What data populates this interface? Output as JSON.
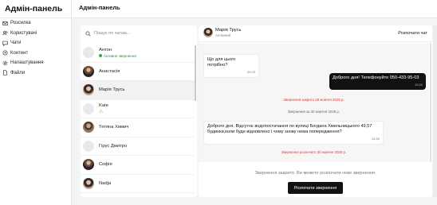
{
  "app": {
    "brand": "Адмін-панель",
    "page_title": "Адмін-панель"
  },
  "sidebar": {
    "items": [
      {
        "label": "Розсилка",
        "icon": "mail-icon"
      },
      {
        "label": "Користувачі",
        "icon": "users-icon"
      },
      {
        "label": "Чати",
        "icon": "chat-icon"
      },
      {
        "label": "Контент",
        "icon": "content-icon"
      },
      {
        "label": "Налаштування",
        "icon": "gear-icon"
      },
      {
        "label": "Файли",
        "icon": "file-icon"
      }
    ]
  },
  "chat_list": {
    "search_placeholder": "Пошук по чатам...",
    "items": [
      {
        "name": "Антон",
        "status": "Активне звернення"
      },
      {
        "name": "Анастасія"
      },
      {
        "name": "Марія Трусь"
      },
      {
        "name": "Kate",
        "badge": "⚠"
      },
      {
        "name": "Тетяна Химич"
      },
      {
        "name": "Гірус Дмитро"
      },
      {
        "name": "Софія"
      },
      {
        "name": "Nadja"
      }
    ]
  },
  "chat": {
    "contact_name": "Марія Трусь",
    "contact_status": "Активний",
    "start_label": "Розпочати чат",
    "messages": {
      "m1_text": "Що для цього потрібно?",
      "m1_time": "09:25",
      "m2_text": "Доброго дня! Телефонуйте 050-433-95-03",
      "m2_time": "10:22",
      "sys1": "Звернення закрито 29 жовтня 2025 р.",
      "sys2": "Звернення за 30 жовтня 2025 р.",
      "m3_text": "Доброго дня. Відсутнє водопостачання по вулиці Богдана Хмельницького 49,57 будинки,коли буде відновлено і чому знову нема попередження?",
      "m3_time": "14:55",
      "sys3": "Звернення розпочато 30 жовтня 2025 р."
    },
    "closed_note": "Звернення закрито. Ви можете розпочати нове звернення.",
    "start_request_label": "Розпочати звернення"
  }
}
